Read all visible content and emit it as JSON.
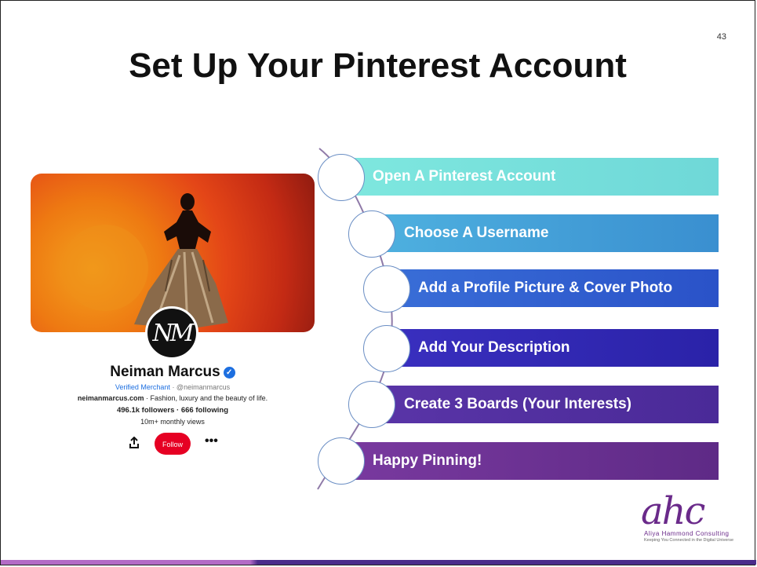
{
  "slide": {
    "page_number": "43",
    "title": "Set Up Your Pinterest Account"
  },
  "profile": {
    "avatar_text": "NM",
    "name": "Neiman Marcus",
    "verified_label": "Verified Merchant",
    "handle": "· @neimanmarcus",
    "website": "neimanmarcus.com",
    "description": "· Fashion, luxury and the beauty of life.",
    "stats": "496.1k followers · 666 following",
    "views": "10m+ monthly views",
    "follow_label": "Follow"
  },
  "steps": [
    {
      "label": "Open A Pinterest Account",
      "color": "#6fe0d6"
    },
    {
      "label": "Choose A Username",
      "color": "#3fa2d8"
    },
    {
      "label": "Add a Profile Picture & Cover Photo",
      "color": "#2f5fcf"
    },
    {
      "label": "Add Your Description",
      "color": "#3a2fb8"
    },
    {
      "label": "Create 3 Boards (Your Interests)",
      "color": "#5a2f9e"
    },
    {
      "label": "Happy Pinning!",
      "color": "#6a2a8a"
    }
  ],
  "logo": {
    "mark": "ahc",
    "name": "Aliya Hammond Consulting",
    "tagline": "Keeping You Connected in the Digital Universe"
  }
}
